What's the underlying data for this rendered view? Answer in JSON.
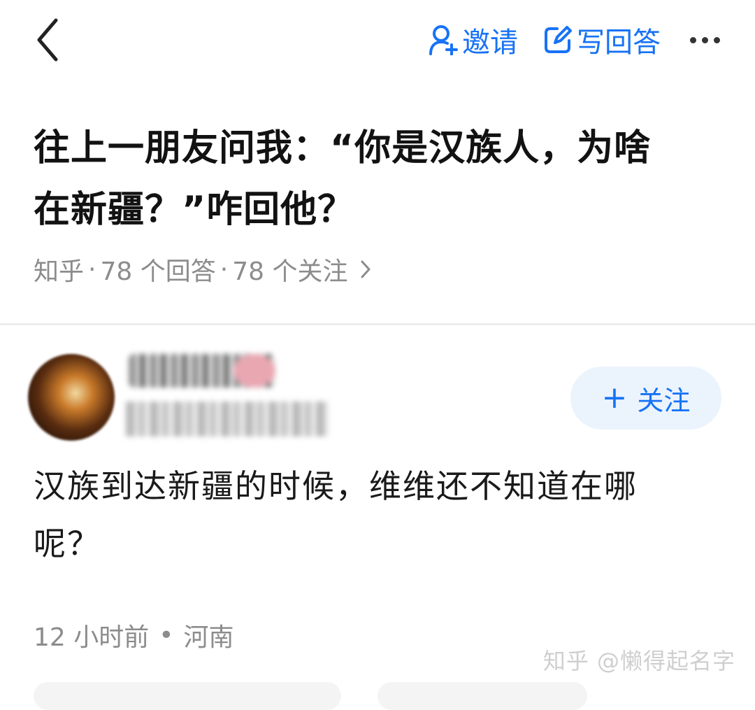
{
  "topbar": {
    "back_icon": "chevron-left-icon",
    "invite_label": "邀请",
    "invite_icon": "user-plus-icon",
    "write_label": "写回答",
    "write_icon": "edit-icon",
    "more_icon": "more-dots-icon",
    "accent_color": "#1772f6"
  },
  "question": {
    "title_line1": "往上一朋友问我：“你是汉族人，为啥",
    "title_line2": "在新疆？”咋回他？",
    "source": "知乎",
    "answers": "78 个回答",
    "followers": "78 个关注",
    "sep": "·"
  },
  "answer": {
    "follow_label": "关注",
    "follow_plus": "+",
    "text_line1": "汉族到达新疆的时候，维维还不知道在哪",
    "text_line2": "呢？",
    "time": "12 小时前",
    "location": "河南",
    "dot": "•"
  },
  "watermark": "知乎 @懒得起名字"
}
